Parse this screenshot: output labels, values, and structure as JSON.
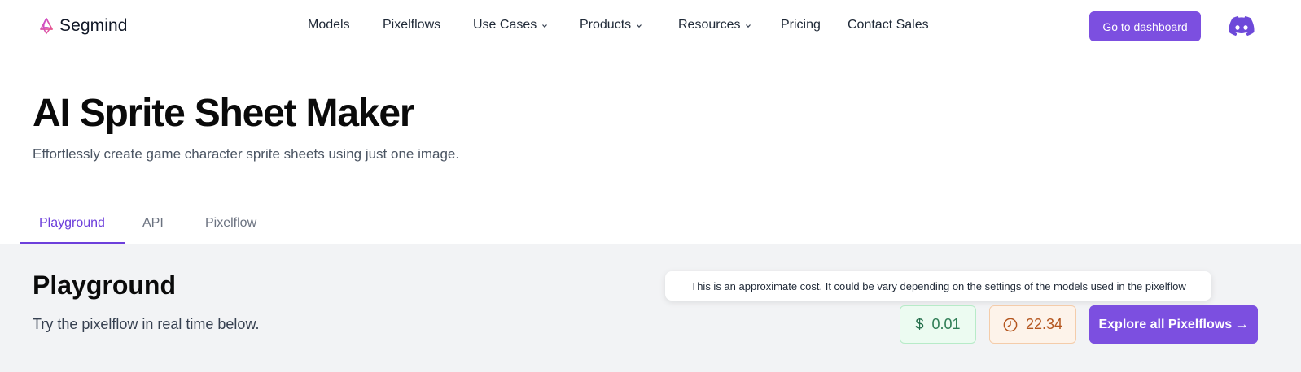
{
  "header": {
    "logo_text": "Segmind",
    "nav": [
      {
        "label": "Models",
        "dropdown": false
      },
      {
        "label": "Pixelflows",
        "dropdown": false
      },
      {
        "label": "Use Cases",
        "dropdown": true
      },
      {
        "label": "Products",
        "dropdown": true
      },
      {
        "label": "Resources",
        "dropdown": true
      },
      {
        "label": "Pricing",
        "dropdown": false
      },
      {
        "label": "Contact Sales",
        "dropdown": false
      }
    ],
    "dashboard_label": "Go to dashboard",
    "social_icon": "discord-icon"
  },
  "hero": {
    "title": "AI Sprite Sheet Maker",
    "subtitle": "Effortlessly create game character sprite sheets using just one image."
  },
  "tabs": [
    {
      "label": "Playground",
      "active": true
    },
    {
      "label": "API",
      "active": false
    },
    {
      "label": "Pixelflow",
      "active": false
    }
  ],
  "playground": {
    "title": "Playground",
    "subtitle": "Try the pixelflow in real time below.",
    "tooltip": "This is an approximate cost. It could be vary depending on the settings of the models used in the pixelflow",
    "cost_symbol": "$",
    "cost": "0.01",
    "time": "22.34",
    "explore_label": "Explore all Pixelflows →"
  },
  "colors": {
    "brand": "#7c4fe0",
    "active_tab": "#6d3fdb",
    "section_bg": "#f2f3f5",
    "cost_bg": "#ecfbf1",
    "cost_text": "#2e7d55",
    "time_bg": "#fdf3ea",
    "time_text": "#b4561f"
  }
}
